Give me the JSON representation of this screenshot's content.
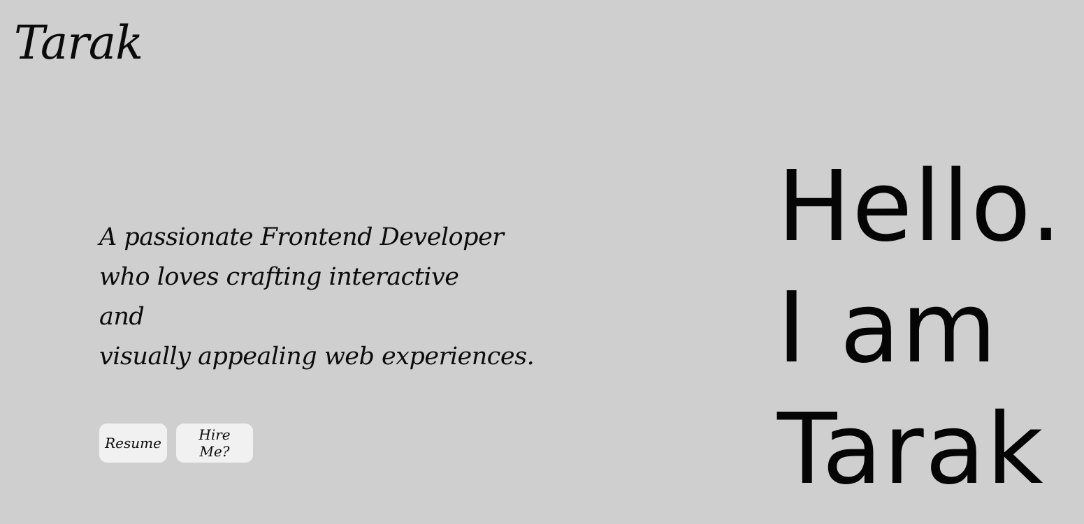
{
  "header": {
    "logo_text": "Tarak"
  },
  "intro": {
    "tagline_lines": [
      "A passionate Frontend Developer",
      "who loves crafting interactive",
      "and",
      "visually appealing web experiences."
    ]
  },
  "actions": {
    "resume_label": "Resume",
    "hire_label": "Hire Me?"
  },
  "hero": {
    "lines": [
      "Hello.",
      "I am",
      "Tarak"
    ]
  },
  "colors": {
    "background": "#cfcfcf",
    "text": "#0a0a0a",
    "button_bg": "#f1f1f1"
  }
}
